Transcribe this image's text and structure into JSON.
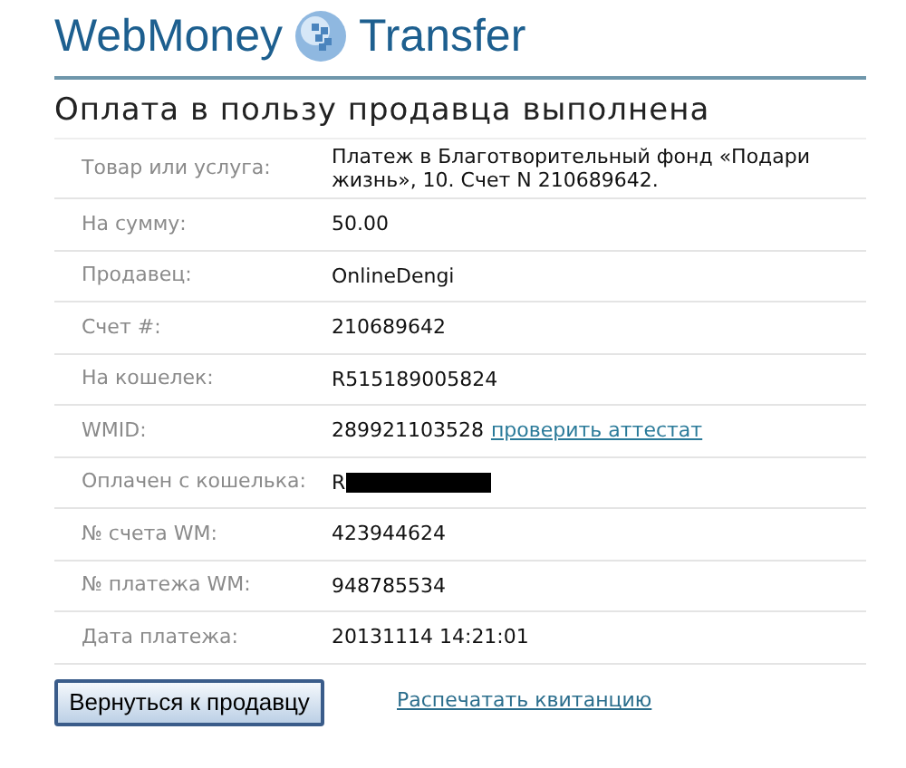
{
  "logo": {
    "left": "WebMoney",
    "right": "Transfer"
  },
  "title": "Оплата в пользу продавца выполнена",
  "rows": [
    {
      "kind": "text",
      "label": "Товар или услуга:",
      "value": "Платеж в Благотворительный фонд «Подари жизнь», 10. Счет N 210689642."
    },
    {
      "kind": "text",
      "label": "На сумму:",
      "value": "50.00"
    },
    {
      "kind": "text",
      "label": "Продавец:",
      "value": "OnlineDengi"
    },
    {
      "kind": "text",
      "label": "Счет #:",
      "value": "210689642"
    },
    {
      "kind": "text",
      "label": "На кошелек:",
      "value": "R515189005824"
    },
    {
      "kind": "link",
      "label": "WMID:",
      "value": "289921103528",
      "link": "проверить аттестат"
    },
    {
      "kind": "redacted",
      "label": "Оплачен с кошелька:",
      "value": "R"
    },
    {
      "kind": "text",
      "label": "№ счета WM:",
      "value": "423944624"
    },
    {
      "kind": "text",
      "label": "№ платежа WM:",
      "value": "948785534"
    },
    {
      "kind": "text",
      "label": "Дата платежа:",
      "value": "20131114 14:21:01"
    }
  ],
  "actions": {
    "button": "Вернуться к продавцу",
    "link": "Распечатать квитанцию"
  }
}
